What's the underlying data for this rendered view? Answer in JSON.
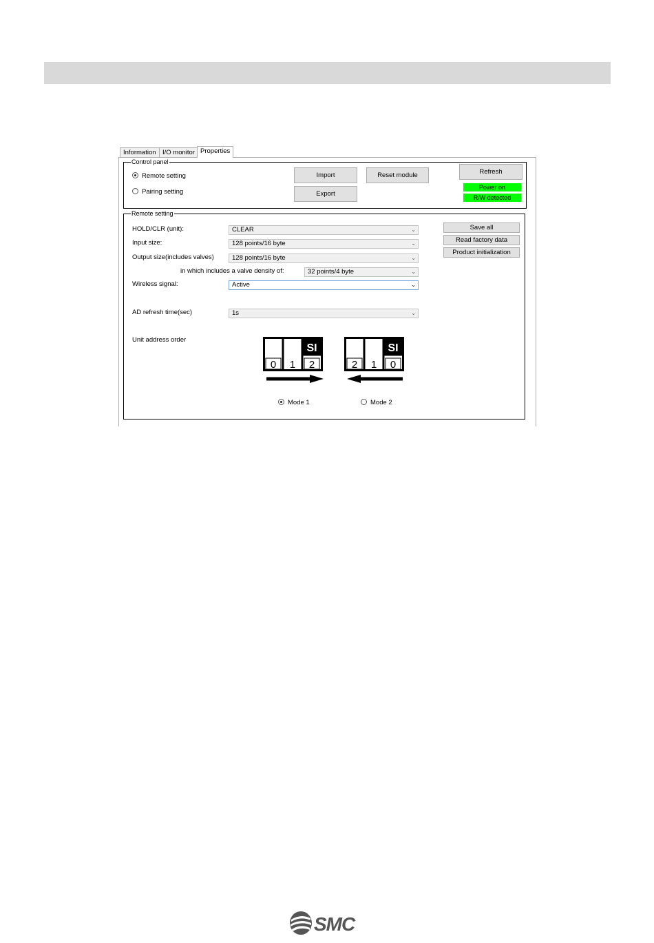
{
  "tabs": [
    "Information",
    "I/O monitor",
    "Properties"
  ],
  "control_panel": {
    "title": "Control panel",
    "remote_setting": "Remote setting",
    "pairing_setting": "Pairing setting",
    "import_label": "Import",
    "export_label": "Export",
    "reset_label": "Reset module",
    "refresh_label": "Refresh",
    "power_status": "Power on",
    "rw_status": "R/W detected"
  },
  "remote": {
    "title": "Remote setting",
    "hold_label": "HOLD/CLR (unit):",
    "hold_value": "CLEAR",
    "input_label": "Input size:",
    "input_value": "128 points/16 byte",
    "output_label": "Output size(includes valves)",
    "output_value": "128 points/16 byte",
    "valve_label": "in which includes a valve density of:",
    "valve_value": "32 points/4 byte",
    "wireless_label": "Wireless signal:",
    "wireless_value": "Active",
    "ad_label": "AD refresh time(sec)",
    "ad_value": "1s",
    "unit_order_label": "Unit address order",
    "save_all": "Save all",
    "read_factory": "Read factory data",
    "product_init": "Product initialization",
    "mode1": "Mode 1",
    "mode2": "Mode 2",
    "mode1_digits": [
      "0",
      "1",
      "2"
    ],
    "mode2_digits": [
      "2",
      "1",
      "0"
    ],
    "si_label": "SI"
  },
  "logo_text": "SMC"
}
